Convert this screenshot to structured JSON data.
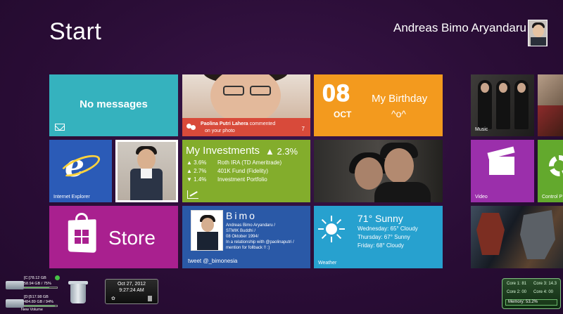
{
  "header": {
    "title": "Start",
    "user_name": "Andreas Bimo Aryandaru"
  },
  "tiles": {
    "messaging": {
      "text": "No messages"
    },
    "people": {
      "name": "Paolina Putri Lahera",
      "action": "commented",
      "line2": "on your photo",
      "count": "7"
    },
    "birthday": {
      "day": "08",
      "month": "OCT",
      "title": "My Birthday",
      "emoticon": "^o^"
    },
    "music": {
      "label": "Music"
    },
    "internet_explorer": {
      "label": "Internet Explorer"
    },
    "investments": {
      "title": "My Investments",
      "change": "▲ 2.3%",
      "rows": [
        {
          "pct": "▲ 3.6%",
          "name": "Roth IRA (TD Ameritrade)"
        },
        {
          "pct": "▲ 2.7%",
          "name": "401K Fund (Fidelity)"
        },
        {
          "pct": "▼ 1.4%",
          "name": "Investment Portfolio"
        }
      ]
    },
    "video": {
      "label": "Video"
    },
    "control_panel": {
      "label": "Control P"
    },
    "store": {
      "label": "Store"
    },
    "profile": {
      "name": "Bimo",
      "bio1": "Andreas Bimo Aryandaru /",
      "bio2": "STMIK Buddhi /",
      "bio3": "08 Oktober 1994/",
      "bio4": "In a relationship with @paolinaputri /",
      "bio5": "mention for follback !! :)",
      "tweet": "tweet @_bimonesia"
    },
    "weather": {
      "now": "71° Sunny",
      "wed": "Wednesday: 65° Cloudy",
      "thu": "Thursday: 67° Sunny",
      "fri": "Friday: 68° Cloudy",
      "label": "Weather"
    }
  },
  "gadgets": {
    "drive_c": {
      "name": "[C:]78.12 GB",
      "free": "58.94 GB / 75%"
    },
    "drive_d": {
      "name": "[D:]517.98 GB",
      "free": "484.89 GB / 94%",
      "label": "New Volume"
    },
    "clock": {
      "date": "Oct 27, 2012",
      "time": "9:27:24 AM"
    },
    "cpu": {
      "core1": "Core 1: 81",
      "core2": "Core 2: 00",
      "core3": "Core 3: 14.3",
      "core4": "Core 4: 00",
      "memory": "Memory: 53.2%"
    }
  },
  "colors": {
    "background": "#2d0f3a",
    "messaging": "#35b2be",
    "people": "#d84a3a",
    "birthday": "#f39a1e",
    "ie": "#2b5bb7",
    "investments": "#83ad2c",
    "video": "#9b2fab",
    "control": "#63a92d",
    "store": "#a9208f",
    "profile": "#2a59a7",
    "weather": "#27a1cf"
  }
}
